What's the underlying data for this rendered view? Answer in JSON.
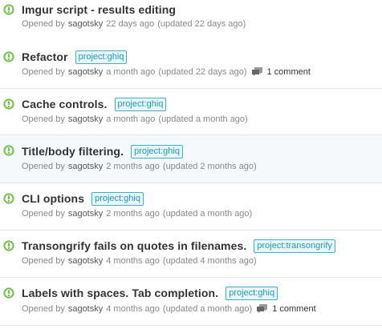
{
  "issues": [
    {
      "title": "Imgur script - results editing",
      "label": "",
      "opened_prefix": "Opened by",
      "author": "sagotsky",
      "age": "22 days ago",
      "updated": "(updated 22 days ago)",
      "comments": ""
    },
    {
      "title": "Refactor",
      "label": "project:ghiq",
      "opened_prefix": "Opened by",
      "author": "sagotsky",
      "age": "a month ago",
      "updated": "(updated 22 days ago)",
      "comments": "1 comment"
    },
    {
      "title": "Cache controls.",
      "label": "project:ghiq",
      "opened_prefix": "Opened by",
      "author": "sagotsky",
      "age": "a month ago",
      "updated": "(updated a month ago)",
      "comments": ""
    },
    {
      "title": "Title/body filtering.",
      "label": "project:ghiq",
      "opened_prefix": "Opened by",
      "author": "sagotsky",
      "age": "2 months ago",
      "updated": "(updated 2 months ago)",
      "comments": ""
    },
    {
      "title": "CLI options",
      "label": "project:ghiq",
      "opened_prefix": "Opened by",
      "author": "sagotsky",
      "age": "2 months ago",
      "updated": "(updated a month ago)",
      "comments": ""
    },
    {
      "title": "Transongrify fails on quotes in filenames.",
      "label": "project:transongrify",
      "opened_prefix": "Opened by",
      "author": "sagotsky",
      "age": "4 months ago",
      "updated": "(updated 4 months ago)",
      "comments": ""
    },
    {
      "title": "Labels with spaces. Tab completion.",
      "label": "project:ghiq",
      "opened_prefix": "Opened by",
      "author": "sagotsky",
      "age": "4 months ago",
      "updated": "(updated a month ago)",
      "comments": "1 comment"
    }
  ],
  "colors": {
    "open_icon": "#6cc644",
    "label_text": "#1f9ab8",
    "label_border": "#3eb0cc",
    "title_text": "#333333",
    "meta_text": "#888888"
  },
  "icons": {
    "status": "issue-opened-icon",
    "comment": "comment-icon"
  }
}
